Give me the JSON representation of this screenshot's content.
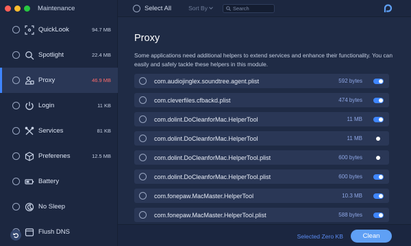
{
  "window": {
    "title": "Maintenance"
  },
  "sidebar": {
    "items": [
      {
        "label": "QuickLook",
        "size": "94.7 MB",
        "icon": "quicklook-icon"
      },
      {
        "label": "Spotlight",
        "size": "22.4 MB",
        "icon": "spotlight-icon"
      },
      {
        "label": "Proxy",
        "size": "46.9 MB",
        "icon": "proxy-icon",
        "active": true
      },
      {
        "label": "Login",
        "size": "11 KB",
        "icon": "power-icon"
      },
      {
        "label": "Services",
        "size": "81 KB",
        "icon": "tools-icon"
      },
      {
        "label": "Preferenes",
        "size": "12.5 MB",
        "icon": "preferences-icon"
      },
      {
        "label": "Battery",
        "size": "",
        "icon": "battery-icon"
      },
      {
        "label": "No Sleep",
        "size": "",
        "icon": "moon-icon"
      },
      {
        "label": "Flush DNS",
        "size": "",
        "icon": "dns-icon"
      }
    ]
  },
  "toolbar": {
    "select_all": "Select All",
    "sort_by": "Sort By",
    "search_placeholder": "Search"
  },
  "main": {
    "title": "Proxy",
    "description": "Some applications need additional helpers to extend services and enhance their functionality. You can easily and safely tackle these helpers in this module.",
    "rows": [
      {
        "name": "com.audiojinglex.soundtree.agent.plist",
        "size": "592 bytes",
        "enabled": true
      },
      {
        "name": "com.cleverfiles.cfbackd.plist",
        "size": "474 bytes",
        "enabled": true
      },
      {
        "name": "com.dolint.DoCleanforMac.HelperTool",
        "size": "11 MB",
        "enabled": true
      },
      {
        "name": "com.dolint.DoCleanforMac.HelperTool",
        "size": "11 MB",
        "enabled": false
      },
      {
        "name": "com.dolint.DoCleanforMac.HelperTool.plist",
        "size": "600 bytes",
        "enabled": false
      },
      {
        "name": "com.dolint.DoCleanforMac.HelperTool.plist",
        "size": "600 bytes",
        "enabled": true
      },
      {
        "name": "com.fonepaw.MacMaster.HelperTool",
        "size": "10.3 MB",
        "enabled": true
      },
      {
        "name": "com.fonepaw.MacMaster.HelperTool.plist",
        "size": "588 bytes",
        "enabled": true
      }
    ]
  },
  "footer": {
    "selected_info": "Selected Zero KB",
    "clean_label": "Clean"
  },
  "colors": {
    "accent": "#3f86ff",
    "highlight_size": "#ff6b6b",
    "background": "#1f2b45"
  }
}
